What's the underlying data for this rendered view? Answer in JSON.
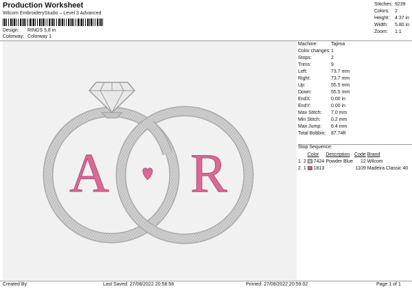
{
  "header": {
    "title": "Production Worksheet",
    "subtitle": "Wilcom EmbroideryStudio – Level 3 Advanced",
    "design_label": "Design:",
    "design_value": "RINGS 5,8 in",
    "colorway_label": "Colorway:",
    "colorway_value": "Colorway 1"
  },
  "top_stats": [
    {
      "label": "Stitches:",
      "value": "9239"
    },
    {
      "label": "Colors:",
      "value": "2"
    },
    {
      "label": "Height:",
      "value": "4.37 in"
    },
    {
      "label": "Width:",
      "value": "5.80 in"
    },
    {
      "label": "Zoom:",
      "value": "1:1"
    }
  ],
  "machine_stats": [
    {
      "label": "Machine:",
      "value": "Tajima"
    },
    {
      "label": "Color changes:",
      "value": "1"
    },
    {
      "label": "Stops:",
      "value": "2"
    },
    {
      "label": "Trims:",
      "value": "9"
    },
    {
      "label": "Left:",
      "value": "73.7 mm"
    },
    {
      "label": "Right:",
      "value": "73.7 mm"
    },
    {
      "label": "Up:",
      "value": "55.5 mm"
    },
    {
      "label": "Down:",
      "value": "55.5 mm"
    },
    {
      "label": "EndX:",
      "value": "0.00 in"
    },
    {
      "label": "EndY:",
      "value": "0.00 in"
    },
    {
      "label": "Max Stitch:",
      "value": "7.0 mm"
    },
    {
      "label": "Min Stitch:",
      "value": "0.2 mm"
    },
    {
      "label": "Max Jump:",
      "value": "6.4 mm"
    },
    {
      "label": "Total Bobbin:",
      "value": "87.74ft"
    }
  ],
  "stop_sequence": {
    "title": "Stop Sequence:",
    "headers": {
      "color": "Color",
      "description": "Description",
      "code": "Code",
      "brand": "Brand"
    },
    "rows": [
      {
        "index": "1.",
        "stop": "2",
        "color": "7424",
        "swatch": "#c9b8d8",
        "description": "Powder Blue",
        "code": "12",
        "brand": "Wilcom"
      },
      {
        "index": "2.",
        "stop": "1",
        "color": "1813",
        "swatch": "#d9578b",
        "description": "",
        "code": "1109",
        "brand": "Madeira Classic 40"
      }
    ]
  },
  "design": {
    "letter_left": "A",
    "letter_right": "R",
    "ring_color": "#c9c9c9",
    "pink": "#d96a95"
  },
  "footer": {
    "created_by": "Created By:",
    "last_saved": "Last Saved: 27/08/2022 20:58:58",
    "printed": "Printed: 27/08/2022 20:59:02",
    "page": "Page 1 of 1"
  }
}
